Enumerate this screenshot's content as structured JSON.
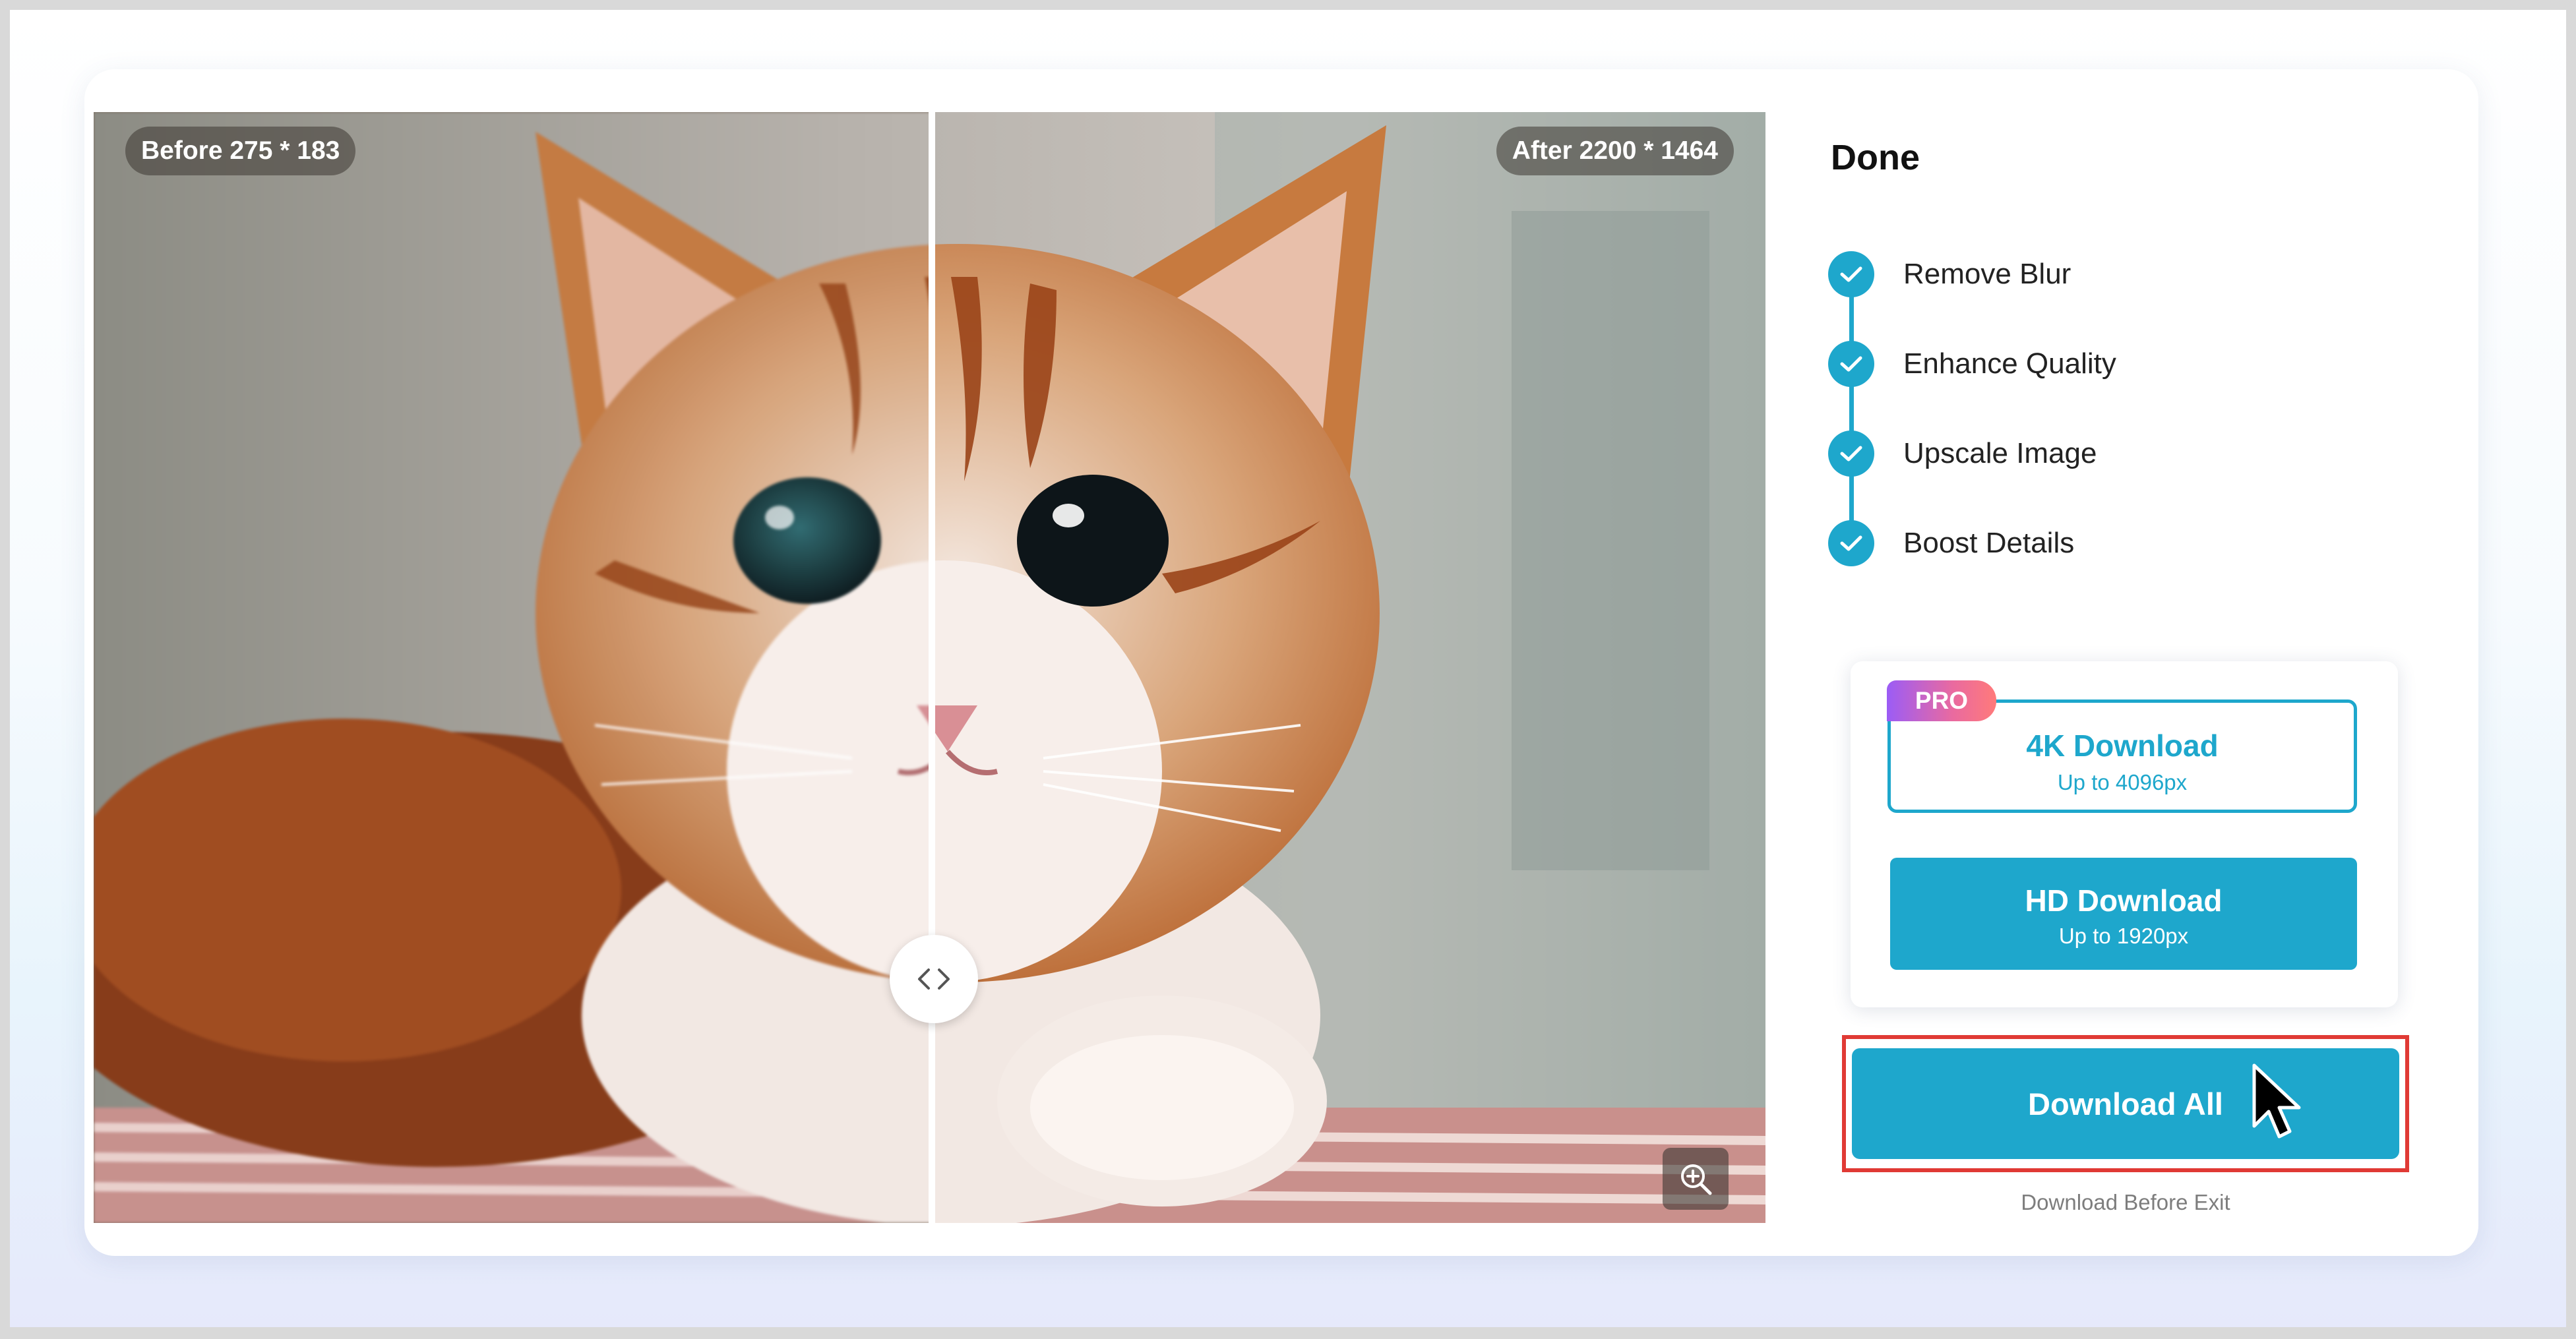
{
  "preview": {
    "before_label": "Before 275 * 183",
    "after_label": "After 2200 * 1464",
    "handle_icon": "chevron-left-right-icon",
    "zoom_icon": "zoom-in-icon"
  },
  "status": {
    "title": "Done",
    "steps": [
      {
        "label": "Remove Blur",
        "icon": "check-icon"
      },
      {
        "label": "Enhance Quality",
        "icon": "check-icon"
      },
      {
        "label": "Upscale Image",
        "icon": "check-icon"
      },
      {
        "label": "Boost Details",
        "icon": "check-icon"
      }
    ]
  },
  "downloads": {
    "pro_badge": "PRO",
    "four_k": {
      "title": "4K Download",
      "subtitle": "Up to 4096px"
    },
    "hd": {
      "title": "HD Download",
      "subtitle": "Up to 1920px"
    },
    "all": {
      "label": "Download All"
    },
    "note": "Download Before Exit"
  },
  "colors": {
    "accent": "#1ea7cc",
    "highlight": "#e03a35",
    "pro_gradient_start": "#9b5cf6",
    "pro_gradient_end": "#ff7a7a"
  }
}
